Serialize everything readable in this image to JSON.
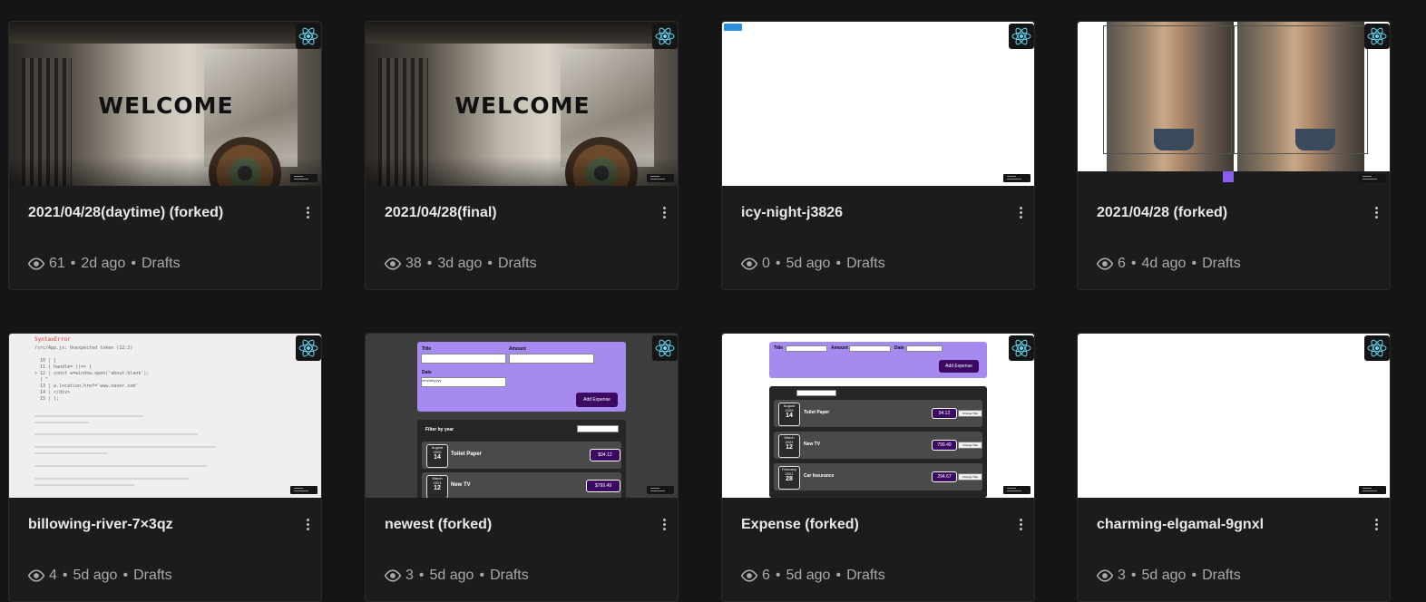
{
  "cards": [
    {
      "title": "2021/04/28(daytime) (forked)",
      "views": "61",
      "age": "2d ago",
      "folder": "Drafts",
      "thumb_text": "WELCOME"
    },
    {
      "title": "2021/04/28(final)",
      "views": "38",
      "age": "3d ago",
      "folder": "Drafts",
      "thumb_text": "WELCOME"
    },
    {
      "title": "icy-night-j3826",
      "views": "0",
      "age": "5d ago",
      "folder": "Drafts"
    },
    {
      "title": "2021/04/28 (forked)",
      "views": "6",
      "age": "4d ago",
      "folder": "Drafts"
    },
    {
      "title": "billowing-river-7×3qz",
      "views": "4",
      "age": "5d ago",
      "folder": "Drafts",
      "thumb": {
        "error_title": "SyntaxError",
        "error_path": "/src/App.js: Unexpected token (12:2)",
        "code_lines": [
          "10 | }",
          "11 | handle= ()=> {",
          "> 12 |   const w=window.open('about:blank');",
          "   |   ^",
          "13 |   w.location.href='www.naver.com'",
          "14 |   </div>",
          "15 | );"
        ]
      }
    },
    {
      "title": "newest (forked)",
      "views": "3",
      "age": "5d ago",
      "folder": "Drafts",
      "thumb": {
        "title_label": "Title",
        "amount_label": "Amount",
        "date_label": "Date",
        "date_placeholder": "mm/dd/yyyy",
        "add_label": "Add Expense",
        "filter_label": "Filter by year",
        "rows": [
          {
            "month": "August",
            "year": "2020",
            "day": "14",
            "name": "Toilet Paper",
            "price": "$94.12"
          },
          {
            "month": "March",
            "year": "2021",
            "day": "12",
            "name": "New TV",
            "price": "$799.49"
          }
        ]
      }
    },
    {
      "title": "Expense (forked)",
      "views": "6",
      "age": "5d ago",
      "folder": "Drafts",
      "thumb": {
        "title_label": "Title",
        "amount_label": "Amount",
        "date_label": "Date",
        "add_label": "Add Expense",
        "change_label": "Change Title",
        "rows": [
          {
            "month": "August",
            "year": "2020",
            "day": "14",
            "name": "Toilet Paper",
            "price": "94.12"
          },
          {
            "month": "March",
            "year": "2021",
            "day": "12",
            "name": "New TV",
            "price": "799.49"
          },
          {
            "month": "February",
            "year": "2021",
            "day": "28",
            "name": "Car Insurance",
            "price": "294.67"
          }
        ]
      }
    },
    {
      "title": "charming-elgamal-9gnxl",
      "views": "3",
      "age": "5d ago",
      "folder": "Drafts"
    }
  ],
  "icons": {
    "framework": "react-icon",
    "views": "eye-icon",
    "menu": "more-vertical-icon"
  },
  "colors": {
    "background": "#151515",
    "react": "#61dafb",
    "accent_purple": "#a58bf0",
    "dark_purple": "#3c0a62"
  }
}
